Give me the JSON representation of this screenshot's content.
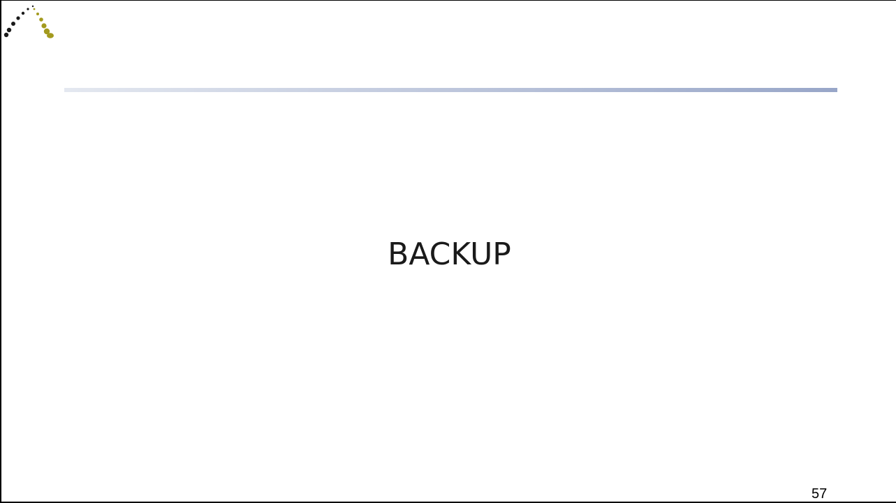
{
  "slide": {
    "title": "BACKUP",
    "page_number": "57"
  },
  "logo": {
    "icon": "dotted-arc-logo-icon",
    "colors": {
      "dark": "#1a1a1a",
      "olive": "#a39a1e"
    }
  },
  "header_rule": {
    "color_start": "#e4e8f0",
    "color_end": "#98a6c8"
  }
}
